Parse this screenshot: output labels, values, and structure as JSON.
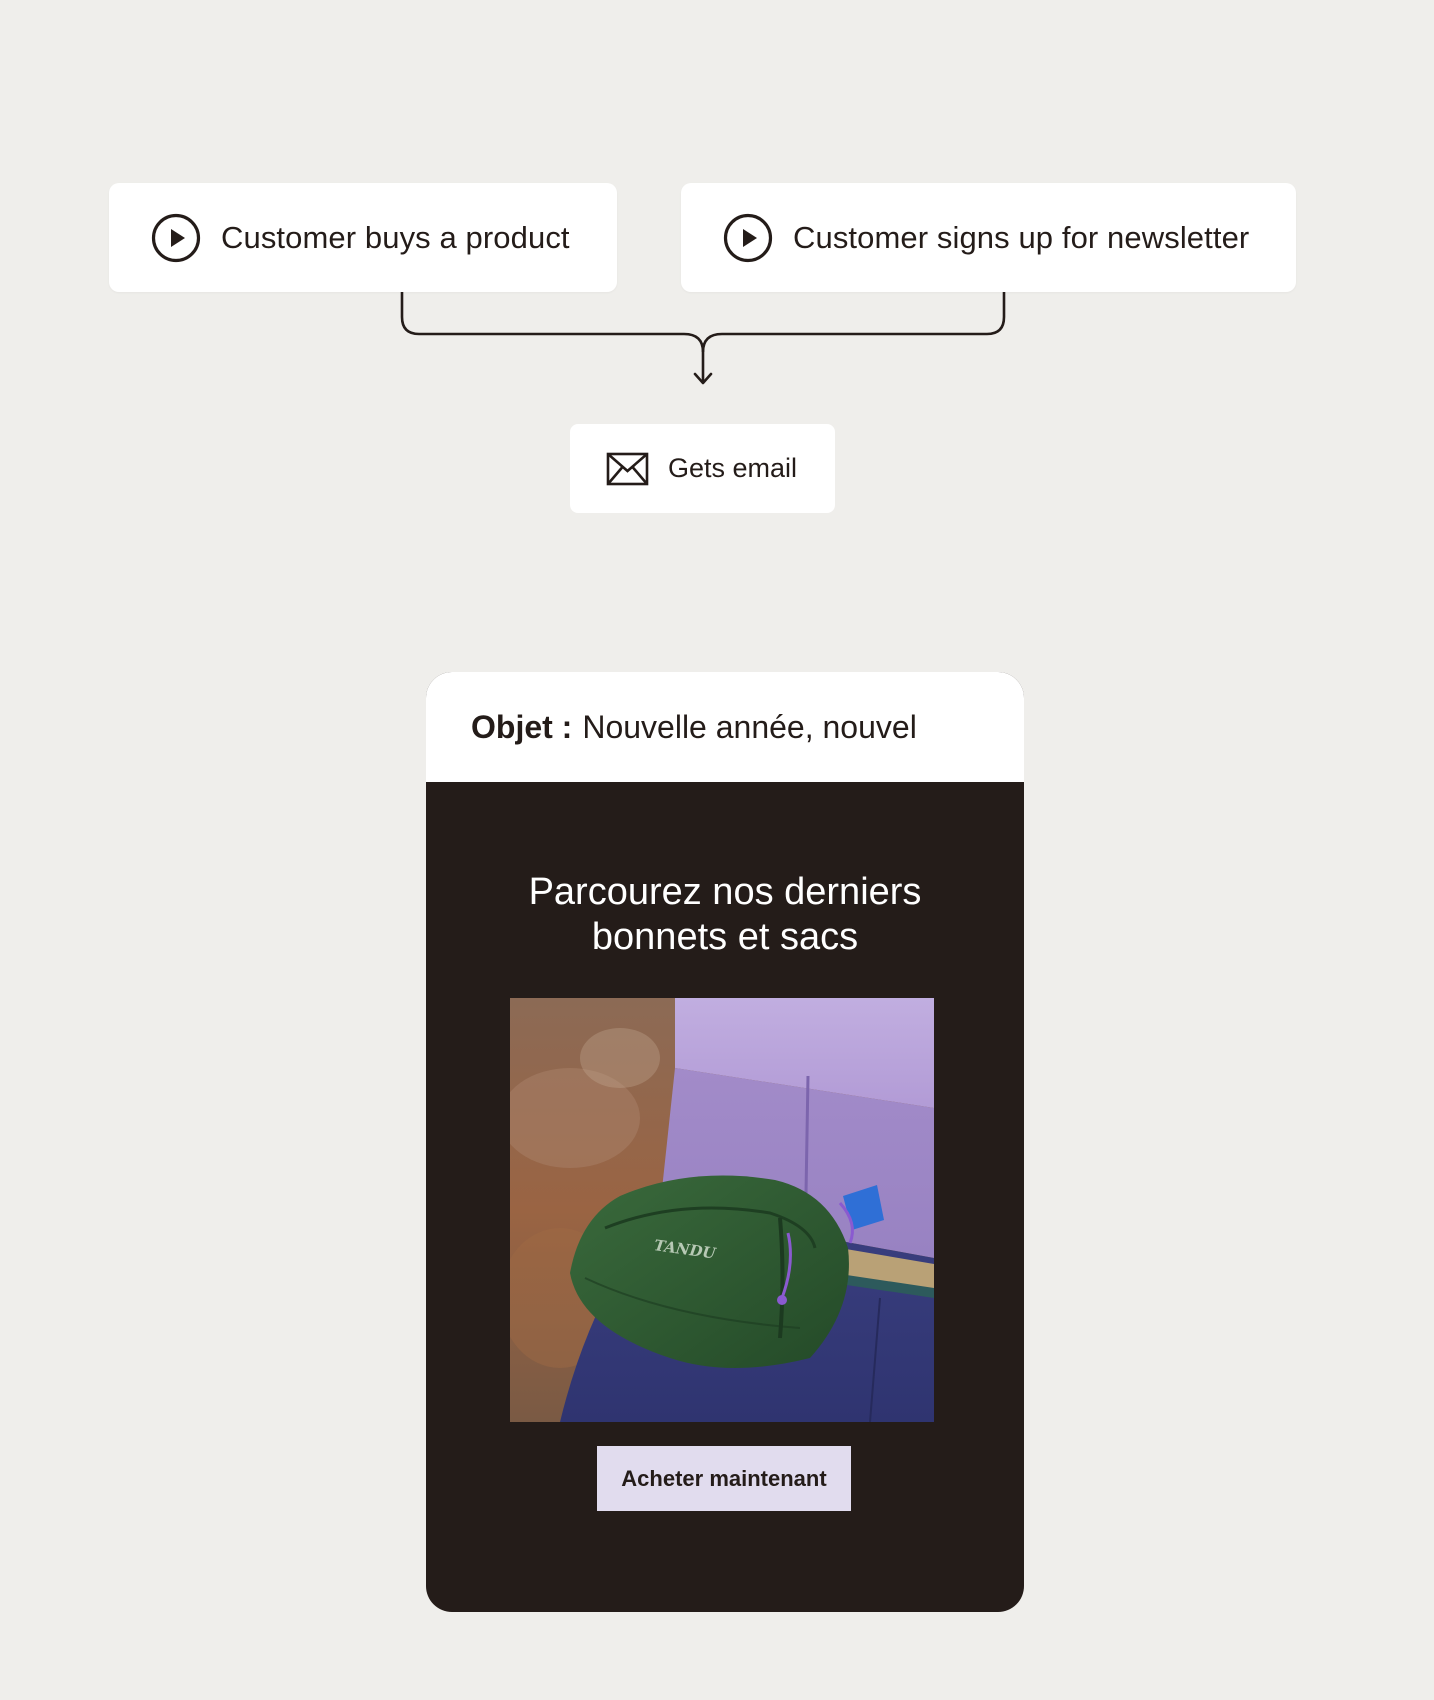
{
  "workflow": {
    "triggers": [
      {
        "label": "Customer buys a product",
        "icon": "play-circle-icon"
      },
      {
        "label": "Customer signs up for newsletter",
        "icon": "play-circle-icon"
      }
    ],
    "action": {
      "label": "Gets email",
      "icon": "envelope-icon"
    }
  },
  "email_preview": {
    "subject_prefix": "Objet :",
    "subject": "Nouvelle année, nouvel",
    "headline_line1": "Parcourez nos derniers",
    "headline_line2": "bonnets et sacs",
    "product_brand": "TANDU",
    "cta_label": "Acheter maintenant"
  },
  "colors": {
    "page_background": "#efeeeb",
    "card_background": "#ffffff",
    "email_background": "#241c19",
    "text_dark": "#241c19",
    "cta_background": "#e1dcee",
    "bag_green": "#2f5a33",
    "shirt_lavender": "#b8a2d8"
  }
}
